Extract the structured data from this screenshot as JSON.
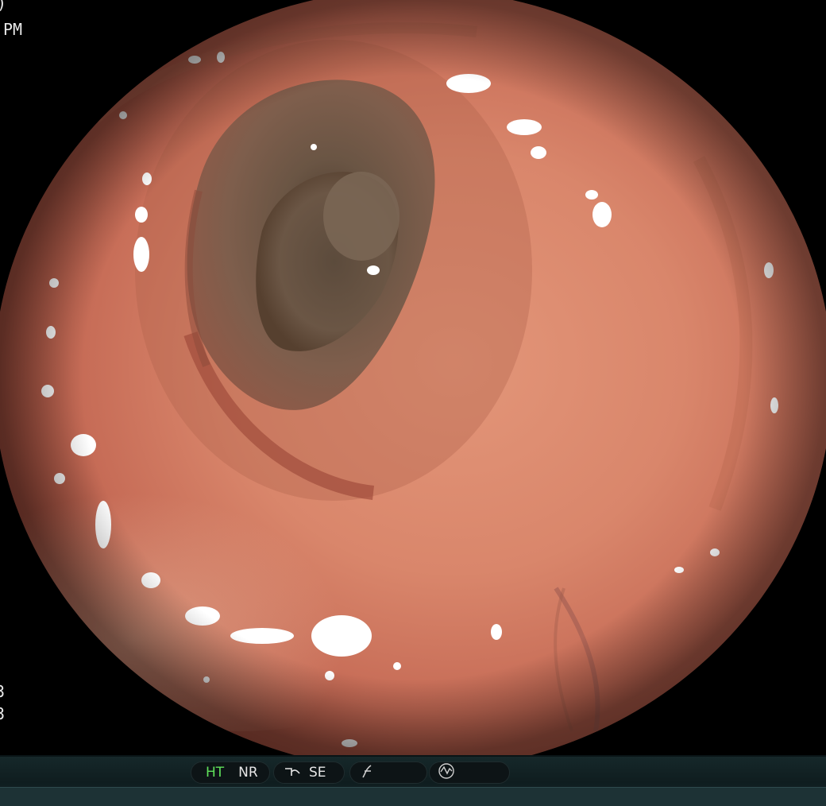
{
  "overlay": {
    "time_suffix": "PM",
    "fragment_top": ")",
    "fragment_lower_1": "3",
    "fragment_lower_2": "3"
  },
  "status_bar": {
    "indicator_1": "HT",
    "indicator_2": "NR",
    "indicator_3": "SE",
    "indicator_1_color": "#5fe05a",
    "icons": [
      "structure-enhancement-icon",
      "gamma-icon",
      "waveform-icon"
    ]
  }
}
